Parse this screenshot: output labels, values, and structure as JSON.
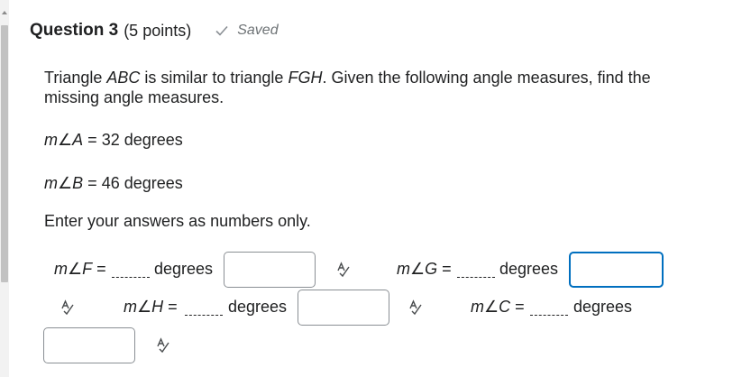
{
  "question": {
    "title": "Question 3",
    "points": "(5 points)",
    "status": "Saved"
  },
  "prompt": {
    "part1": "Triangle ",
    "tri1": "ABC",
    "part2": " is similar to triangle ",
    "tri2": "FGH",
    "part3": ". Given the following angle measures, find the missing angle measures."
  },
  "given": [
    {
      "var": "A",
      "value": "32 degrees"
    },
    {
      "var": "B",
      "value": "46 degrees"
    }
  ],
  "instructions": "Enter your answers as numbers only.",
  "answers": [
    {
      "var": "F",
      "units": "degrees",
      "value": ""
    },
    {
      "var": "G",
      "units": "degrees",
      "value": ""
    },
    {
      "var": "H",
      "units": "degrees",
      "value": ""
    },
    {
      "var": "C",
      "units": "degrees",
      "value": ""
    }
  ],
  "symbols": {
    "m": "m",
    "angle": "∠",
    "equals": "="
  },
  "icons": [
    "check-icon",
    "spellcheck-icon"
  ],
  "colors": {
    "focus_border": "#006fbf",
    "text": "#202122",
    "muted": "#6e7376"
  }
}
